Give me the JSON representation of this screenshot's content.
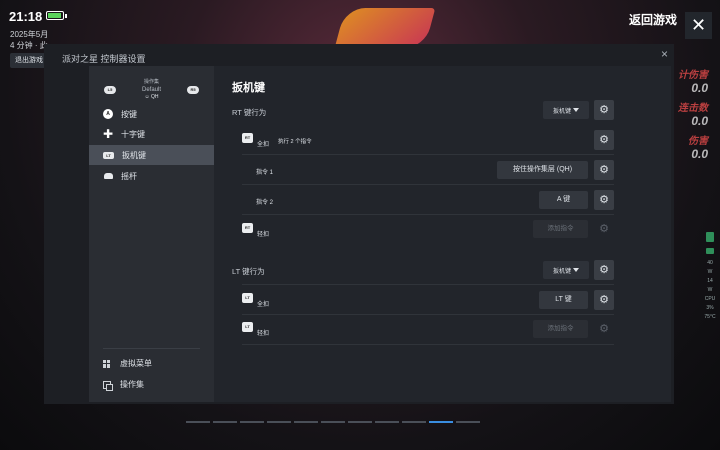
{
  "status": {
    "time": "21:18",
    "date_partial": "2025年5月",
    "elapsed_partial": "4 分钟 · 此",
    "exit_label": "退出游戏",
    "battery_level": 1.0
  },
  "game_controls": {
    "return_label": "返回游戏",
    "close_label": "✕"
  },
  "game_stats": [
    {
      "label": "计伤害",
      "value": "0.0"
    },
    {
      "label": "连击数",
      "value": "0.0"
    },
    {
      "label": "伤害",
      "value": "0.0"
    }
  ],
  "perf": {
    "a": "40",
    "b": "W",
    "c": "14",
    "d": "W",
    "e": "CPU",
    "f": "3%",
    "g": "75°C"
  },
  "dialog": {
    "title": "派对之星 控制器设置",
    "close_label": "×"
  },
  "sidebar": {
    "left_chip": "L5",
    "right_chip": "R5",
    "profile_label": "操作集",
    "profile_name": "Default",
    "profile_user": "QH",
    "items": [
      {
        "label": "按键",
        "icon": "a-button-icon"
      },
      {
        "label": "十字键",
        "icon": "dpad-icon"
      },
      {
        "label": "扳机键",
        "icon": "lt-trigger-icon",
        "active": true
      },
      {
        "label": "摇杆",
        "icon": "joystick-icon"
      }
    ],
    "bottom": [
      {
        "label": "虚拟菜单",
        "icon": "grid-icon"
      },
      {
        "label": "操作集",
        "icon": "copy-icon"
      }
    ]
  },
  "main": {
    "title": "扳机键",
    "rt": {
      "label": "RT 键行为",
      "mode": "扳机键",
      "full_press": {
        "badge": "RT",
        "label": "全扣",
        "note": "执行 2 个指令"
      },
      "commands": [
        {
          "label": "指令 1",
          "value": "按住操作集层 (QH)"
        },
        {
          "label": "指令 2",
          "value": "A 键"
        }
      ],
      "soft_press": {
        "badge": "RT",
        "label": "轻扣",
        "value": "添加指令"
      }
    },
    "lt": {
      "label": "LT 键行为",
      "mode": "扳机键",
      "full_press": {
        "badge": "LT",
        "label": "全扣",
        "value": "LT 键"
      },
      "soft_press": {
        "badge": "LT",
        "label": "轻扣",
        "value": "添加指令"
      }
    }
  },
  "pager": {
    "count": 11,
    "active_index": 9
  }
}
